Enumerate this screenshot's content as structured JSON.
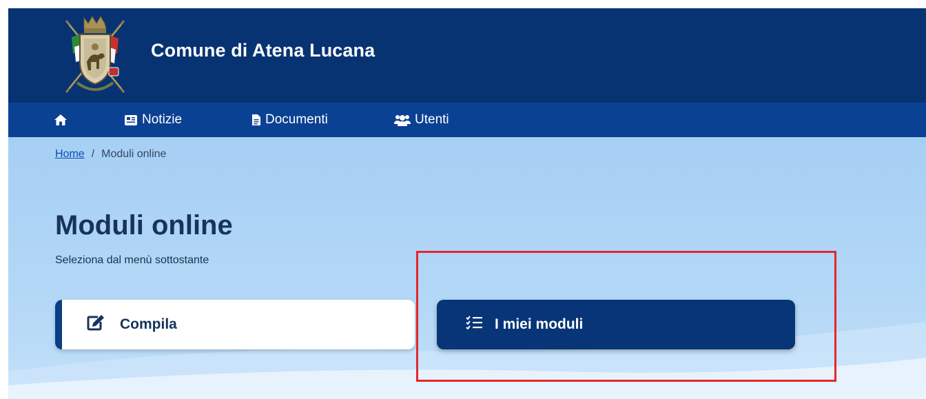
{
  "header": {
    "site_title": "Comune di Atena Lucana",
    "logo_icon": "coat-of-arms-logo"
  },
  "nav": {
    "items": [
      {
        "label": "",
        "icon": "home-icon"
      },
      {
        "label": "Notizie",
        "icon": "newspaper-icon"
      },
      {
        "label": "Documenti",
        "icon": "file-icon"
      },
      {
        "label": "Utenti",
        "icon": "users-icon"
      }
    ]
  },
  "breadcrumb": {
    "home": "Home",
    "separator": "/",
    "current": "Moduli online"
  },
  "main": {
    "title": "Moduli online",
    "subtitle": "Seleziona dal menù sottostante",
    "buttons": {
      "compila": {
        "label": "Compila",
        "icon": "edit-icon"
      },
      "miei_moduli": {
        "label": "I miei moduli",
        "icon": "checklist-icon"
      }
    }
  },
  "colors": {
    "header_bg": "#073372",
    "nav_bg": "#0b4193",
    "content_bg": "#a6cff4",
    "primary_button": "#073577",
    "highlight": "#e3262c"
  }
}
